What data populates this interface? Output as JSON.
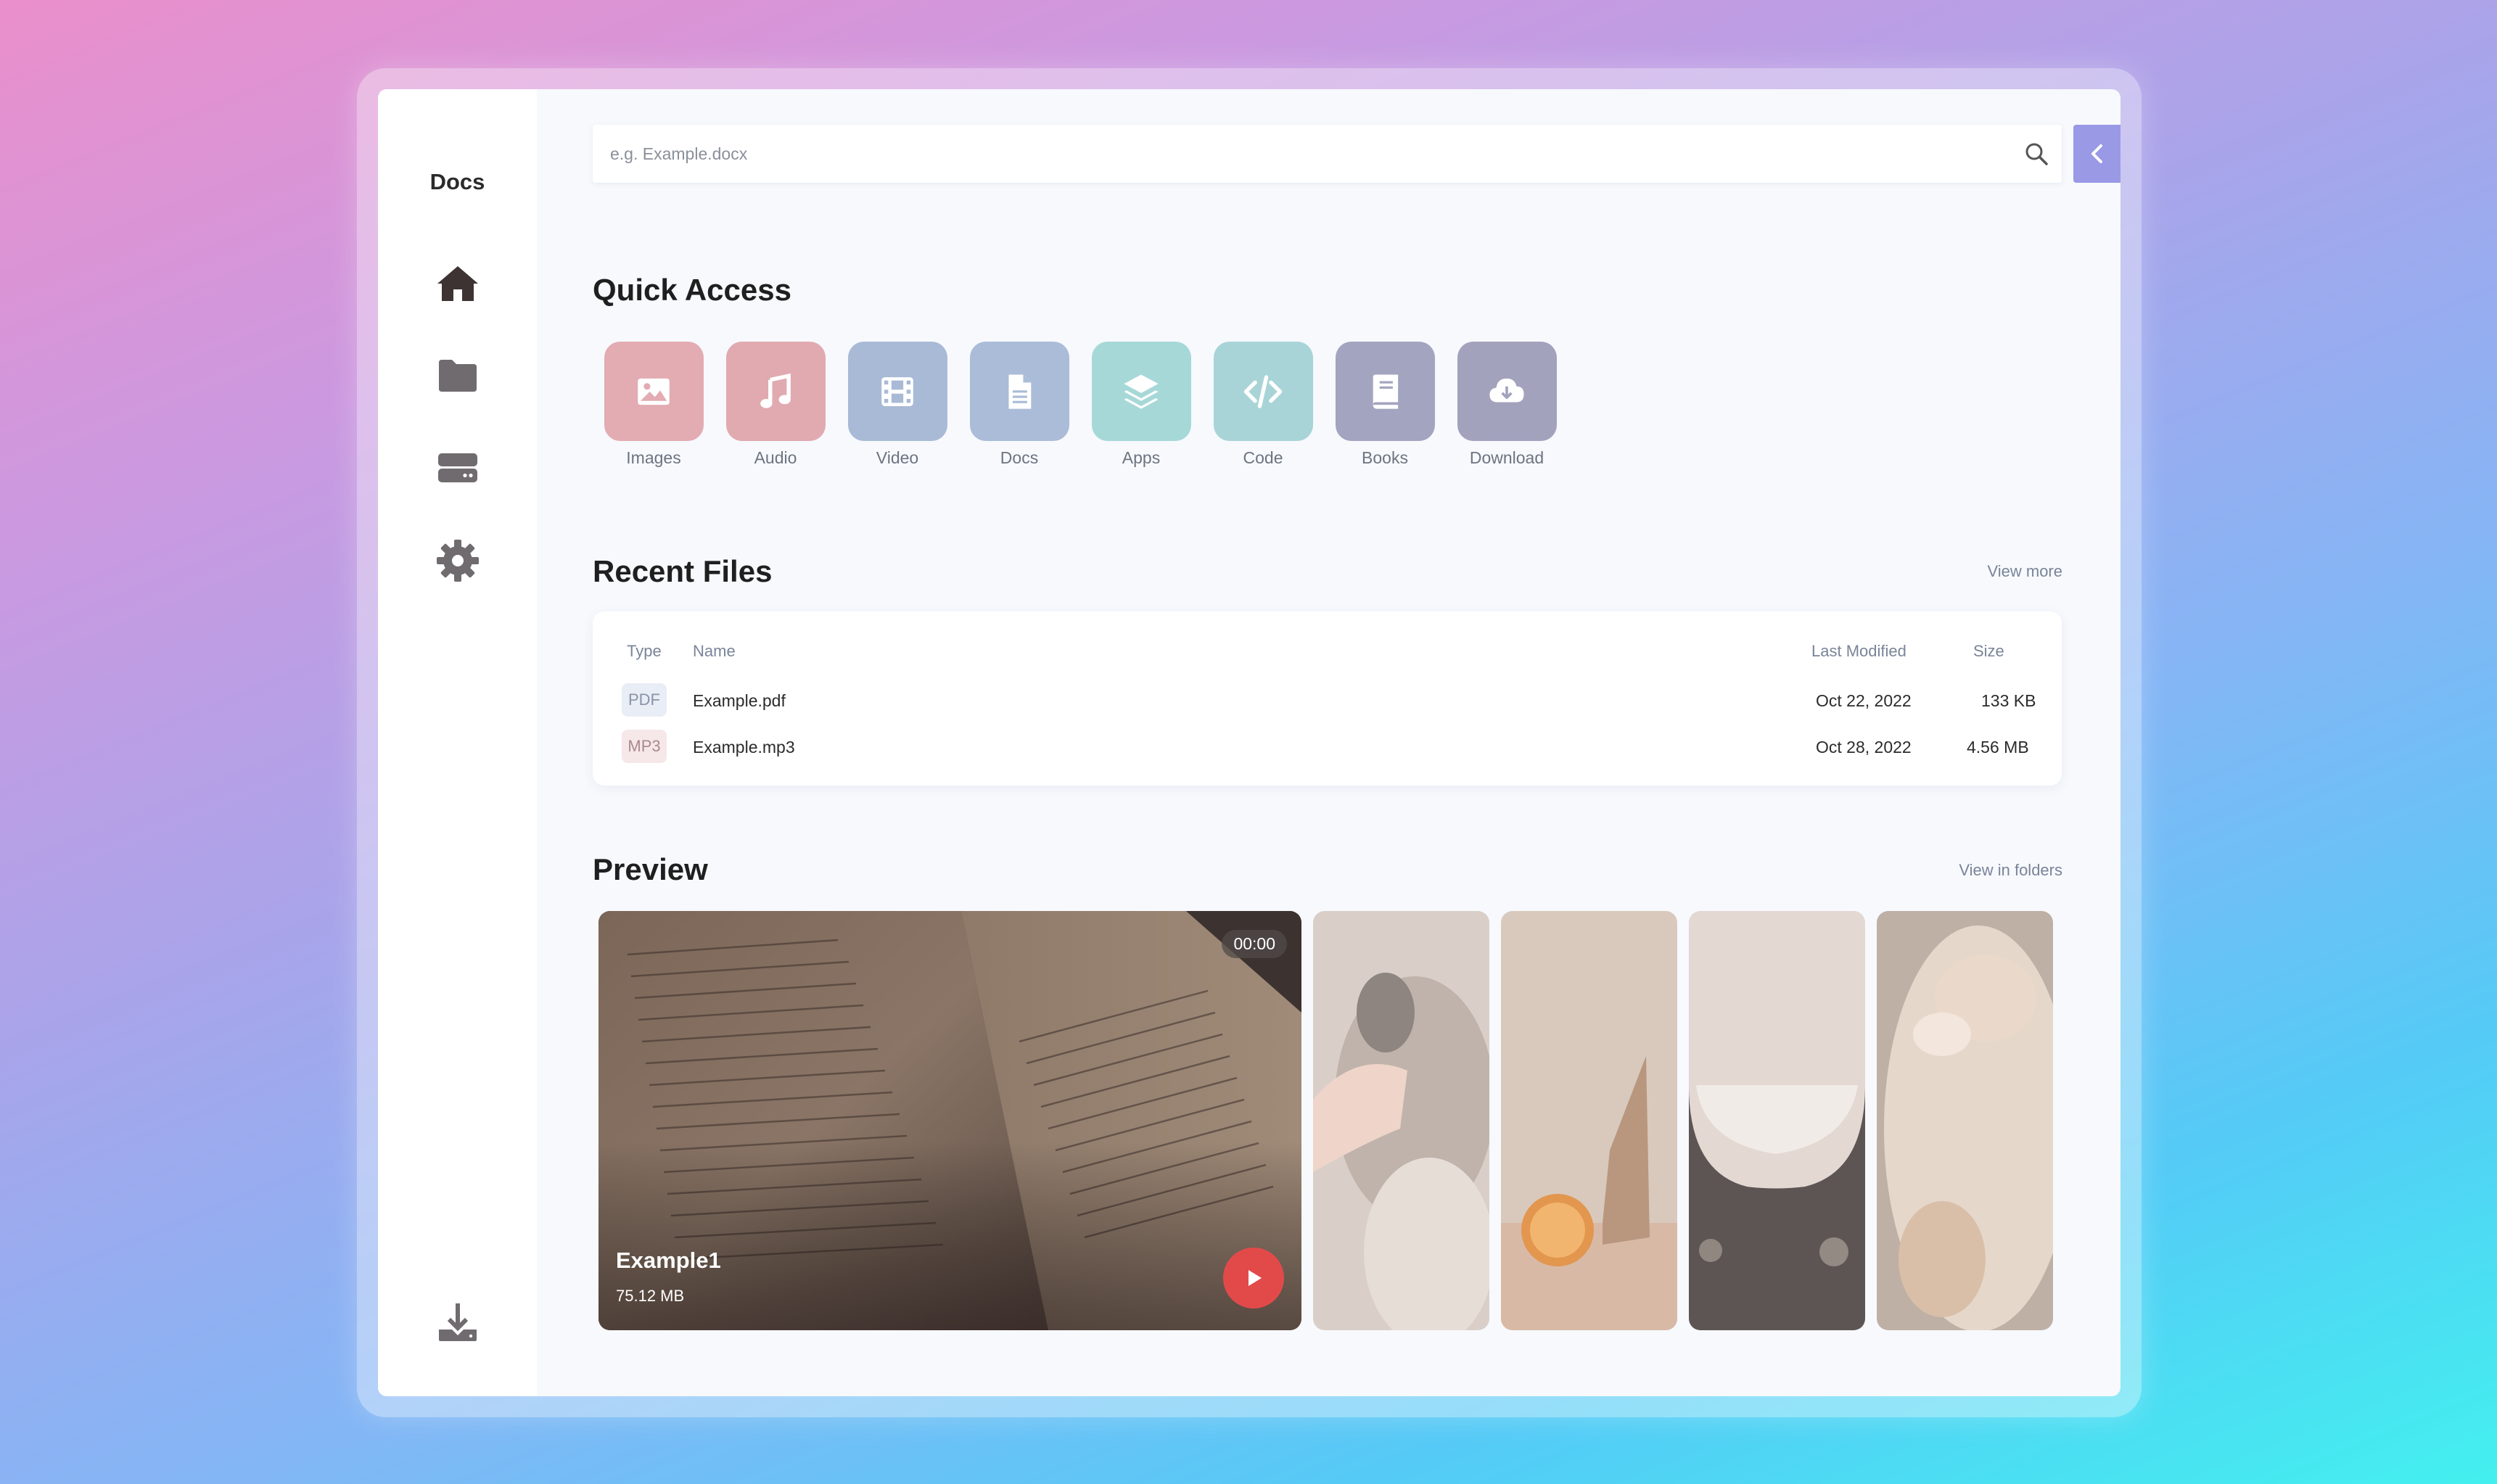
{
  "app": {
    "brand": "Docs"
  },
  "sidebar": {
    "items": [
      {
        "name": "home",
        "icon": "home-icon"
      },
      {
        "name": "folder",
        "icon": "folder-icon"
      },
      {
        "name": "storage",
        "icon": "hard-drive-icon"
      },
      {
        "name": "settings",
        "icon": "gear-icon"
      }
    ],
    "footer_icon": "download-tray-icon"
  },
  "search": {
    "placeholder": "e.g. Example.docx",
    "value": ""
  },
  "quick_access": {
    "title": "Quick Access",
    "items": [
      {
        "label": "Images",
        "icon": "image-icon",
        "color": "#e3abb2"
      },
      {
        "label": "Audio",
        "icon": "music-note-icon",
        "color": "#e0aab0"
      },
      {
        "label": "Video",
        "icon": "film-icon",
        "color": "#a9bad6"
      },
      {
        "label": "Docs",
        "icon": "document-icon",
        "color": "#aabcd8"
      },
      {
        "label": "Apps",
        "icon": "layers-icon",
        "color": "#a7d8d8"
      },
      {
        "label": "Code",
        "icon": "code-icon",
        "color": "#a8d4d7"
      },
      {
        "label": "Books",
        "icon": "book-icon",
        "color": "#a3a4bf"
      },
      {
        "label": "Download",
        "icon": "cloud-download-icon",
        "color": "#a3a2bd"
      }
    ]
  },
  "recent_files": {
    "title": "Recent Files",
    "link": "View more",
    "columns": {
      "type": "Type",
      "name": "Name",
      "modified": "Last Modified",
      "size": "Size"
    },
    "rows": [
      {
        "type": "PDF",
        "name": "Example.pdf",
        "modified": "Oct 22, 2022",
        "size": "133 KB",
        "badge_bg": "#e9edf5",
        "badge_fg": "#8a93a8"
      },
      {
        "type": "MP3",
        "name": "Example.mp3",
        "modified": "Oct 28, 2022",
        "size": "4.56 MB",
        "badge_bg": "#f6e7e8",
        "badge_fg": "#a98a8d"
      }
    ]
  },
  "preview": {
    "title": "Preview",
    "link": "View in folders",
    "featured": {
      "title": "Example1",
      "size": "75.12 MB",
      "duration": "00:00"
    },
    "thumbnails": [
      {
        "name": "rabbit-hand-photo"
      },
      {
        "name": "orange-still-life-photo"
      },
      {
        "name": "cat-paw-photo"
      },
      {
        "name": "sleeping-cat-photo"
      }
    ]
  }
}
